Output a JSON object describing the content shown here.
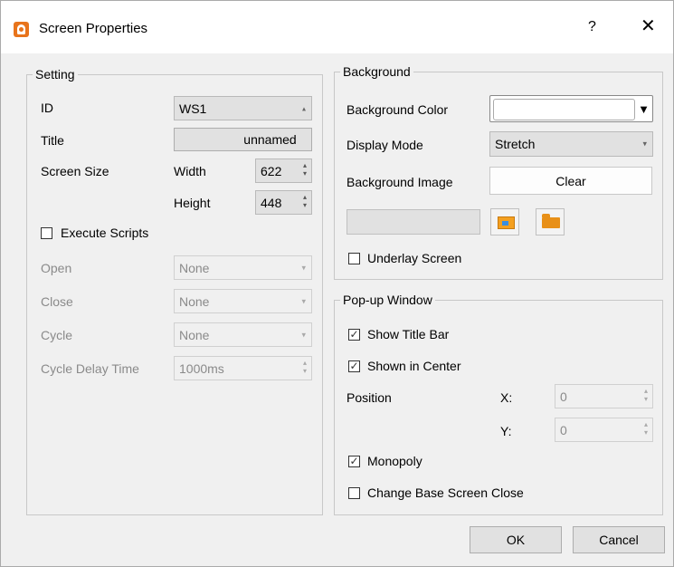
{
  "window": {
    "title": "Screen Properties",
    "help": "?",
    "close": "✕"
  },
  "setting": {
    "legend": "Setting",
    "id_label": "ID",
    "id_value": "WS1",
    "title_label": "Title",
    "title_value": "unnamed",
    "screen_size_label": "Screen Size",
    "width_label": "Width",
    "width_value": "622",
    "height_label": "Height",
    "height_value": "448",
    "execute_scripts_label": "Execute Scripts",
    "execute_scripts_checked": false,
    "open_label": "Open",
    "open_value": "None",
    "close_label": "Close",
    "close_value": "None",
    "cycle_label": "Cycle",
    "cycle_value": "None",
    "cycle_delay_label": "Cycle Delay Time",
    "cycle_delay_value": "1000ms"
  },
  "background": {
    "legend": "Background",
    "color_label": "Background Color",
    "color_value": "#ffffff",
    "display_mode_label": "Display Mode",
    "display_mode_value": "Stretch",
    "image_label": "Background Image",
    "clear_button": "Clear",
    "underlay_label": "Underlay Screen",
    "underlay_checked": false
  },
  "popup": {
    "legend": "Pop-up Window",
    "show_title_bar_label": "Show Title Bar",
    "show_title_bar_checked": true,
    "shown_center_label": "Shown in Center",
    "shown_center_checked": true,
    "position_label": "Position",
    "x_label": "X:",
    "x_value": "0",
    "y_label": "Y:",
    "y_value": "0",
    "monopoly_label": "Monopoly",
    "monopoly_checked": true,
    "change_base_label": "Change Base Screen Close",
    "change_base_checked": false
  },
  "footer": {
    "ok": "OK",
    "cancel": "Cancel"
  },
  "glyphs": {
    "up": "▲",
    "down": "▼",
    "check": "✓"
  }
}
